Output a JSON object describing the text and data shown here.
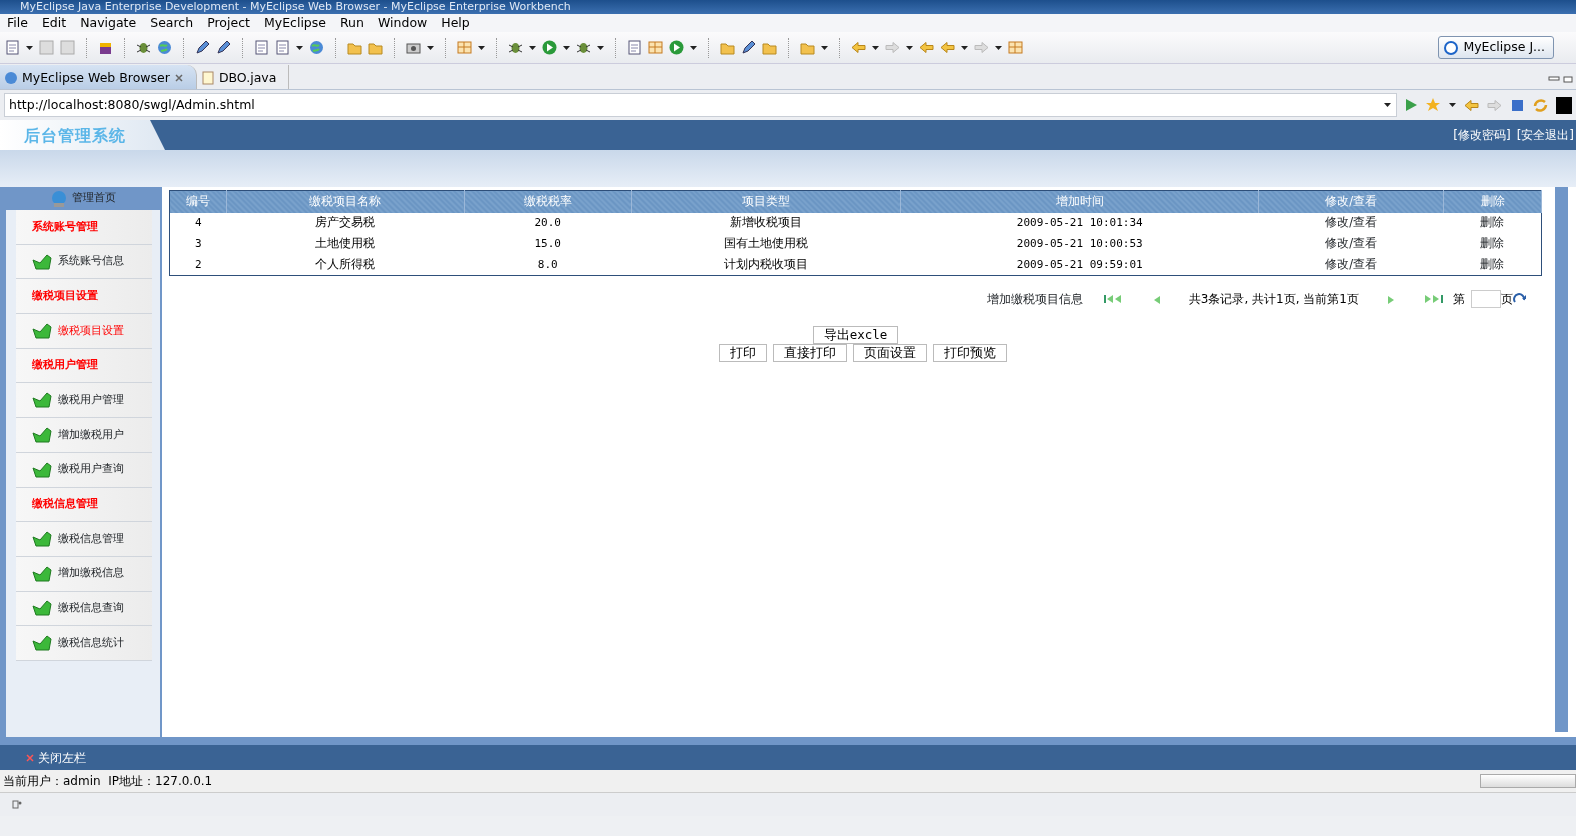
{
  "window": {
    "title": "MyEclipse Java Enterprise Development - MyEclipse Web Browser - MyEclipse Enterprise Workbench"
  },
  "menu": [
    "File",
    "Edit",
    "Navigate",
    "Search",
    "Project",
    "MyEclipse",
    "Run",
    "Window",
    "Help"
  ],
  "perspective": {
    "label": "MyEclipse J..."
  },
  "editor_tabs": [
    {
      "label": "MyEclipse Web Browser",
      "selected": true
    },
    {
      "label": "DBO.java",
      "selected": false
    }
  ],
  "browser": {
    "url": "http://localhost:8080/swgl/Admin.shtml"
  },
  "page": {
    "logo": "后台管理系统",
    "header_links": [
      "[修改密码]",
      "[安全退出]"
    ],
    "home": "管理首页",
    "sidebar": [
      {
        "kind": "header",
        "label": "系统账号管理"
      },
      {
        "kind": "link",
        "label": "系统账号信息",
        "selected": false
      },
      {
        "kind": "header",
        "label": "缴税项目设置"
      },
      {
        "kind": "link",
        "label": "缴税项目设置",
        "selected": true
      },
      {
        "kind": "header",
        "label": "缴税用户管理"
      },
      {
        "kind": "link",
        "label": "缴税用户管理",
        "selected": false
      },
      {
        "kind": "link",
        "label": "增加缴税用户",
        "selected": false
      },
      {
        "kind": "link",
        "label": "缴税用户查询",
        "selected": false
      },
      {
        "kind": "header",
        "label": "缴税信息管理"
      },
      {
        "kind": "link",
        "label": "缴税信息管理",
        "selected": false
      },
      {
        "kind": "link",
        "label": "增加缴税信息",
        "selected": false
      },
      {
        "kind": "link",
        "label": "缴税信息查询",
        "selected": false
      },
      {
        "kind": "link",
        "label": "缴税信息统计",
        "selected": false
      }
    ],
    "table": {
      "columns": [
        "编号",
        "缴税项目名称",
        "缴税税率",
        "项目类型",
        "增加时间",
        "修改/查看",
        "删除"
      ],
      "rows": [
        [
          "4",
          "房产交易税",
          "20.0",
          "新增收税项目",
          "2009-05-21 10:01:34",
          "修改/查看",
          "删除"
        ],
        [
          "3",
          "土地使用税",
          "15.0",
          "国有土地使用税",
          "2009-05-21 10:00:53",
          "修改/查看",
          "删除"
        ],
        [
          "2",
          "个人所得税",
          "8.0",
          "计划内税收项目",
          "2009-05-21 09:59:01",
          "修改/查看",
          "删除"
        ]
      ]
    },
    "add_link": "增加缴税项目信息",
    "pager_info": "共3条记录, 共计1页, 当前第1页",
    "page_prefix": "第",
    "page_suffix": "页",
    "export_button": "导出excle",
    "print_buttons": [
      "打印",
      "直接打印",
      "页面设置",
      "打印预览"
    ],
    "close_sidebar": "关闭左栏",
    "status": "当前用户：admin  IP地址：127.0.0.1"
  }
}
